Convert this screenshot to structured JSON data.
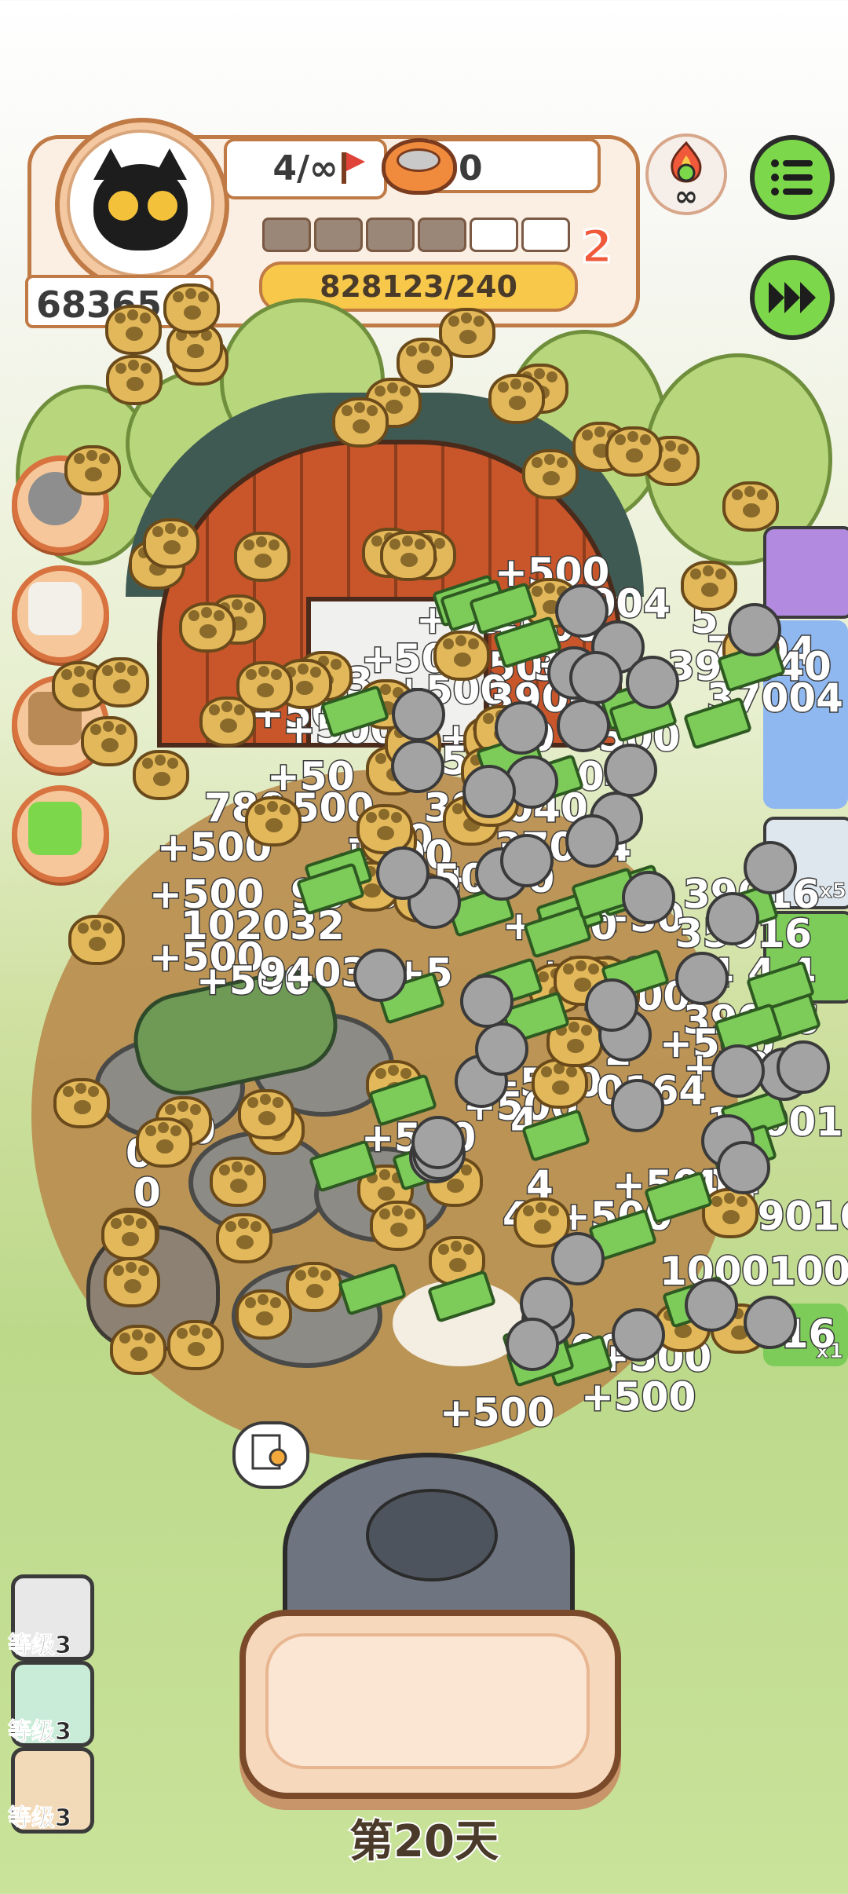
{
  "header": {
    "score": "68365",
    "capacity": "4/∞",
    "bowl_count": "0",
    "level": "2",
    "progress": "828123/240",
    "level_segments_total": 6,
    "level_segments_filled": 4
  },
  "infinity_label": "∞",
  "side_levels": [
    {
      "label": "等级3"
    },
    {
      "label": "等级3"
    },
    {
      "label": "等级3"
    }
  ],
  "timer_count": "1",
  "day_label": "第20天",
  "right_cards": {
    "card_x5": "x5",
    "card_x1": "x1"
  },
  "popups": [
    "+500",
    "27004",
    "+500",
    "+500",
    "5",
    "7004",
    "+500",
    "+500",
    "300",
    "390040",
    "3",
    "+500",
    "39004",
    "+500",
    "+500",
    "+500",
    "37004",
    "+50",
    "+500",
    "+500",
    "004",
    "780",
    "+500",
    "390040",
    "+50",
    "+500",
    "+500",
    "37004",
    "+500",
    "+500",
    "98032",
    "+500",
    "39016",
    "102032",
    "+50",
    "+500",
    "35016",
    "+500",
    "+500",
    "94032",
    "+5",
    "+500",
    "1000",
    "4 4 4",
    "39016",
    "+500",
    "2",
    "+500",
    "+500",
    "0164",
    "+500",
    "4",
    "10001",
    "0",
    "0",
    "0",
    "0",
    "4",
    "+500",
    "4 4",
    "39016",
    "4",
    "+500",
    "1000100",
    "+500",
    "+500",
    "016",
    "+500",
    "+500",
    "+500"
  ],
  "colors": {
    "accent_orange": "#c07a45",
    "progress_yellow": "#f7c84a",
    "button_green": "#7cd84a",
    "level_red": "#f05a3a"
  },
  "icons": {
    "menu": "menu-list-icon",
    "fast_forward": "fast-forward-icon",
    "fire_badge": "fire-infinity-icon",
    "flag": "flag-icon",
    "bowl": "bowl-icon"
  }
}
